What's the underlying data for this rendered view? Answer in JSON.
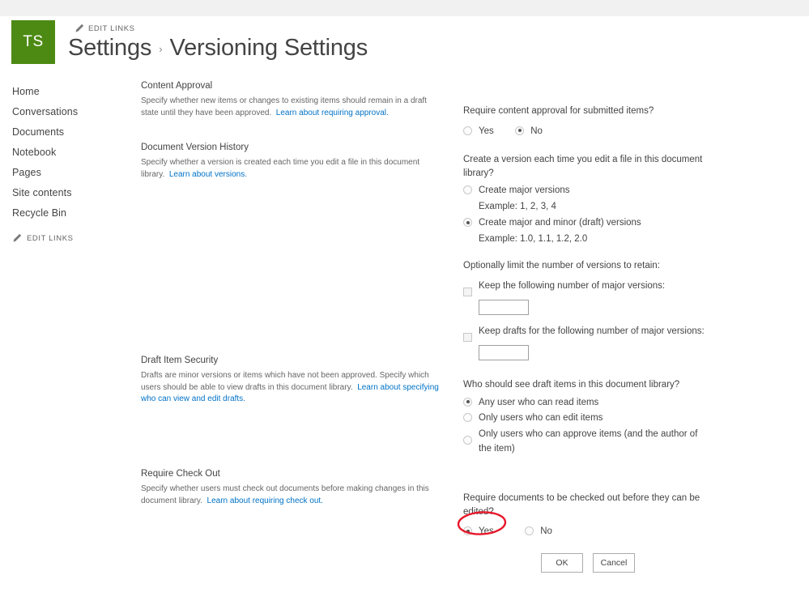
{
  "site": {
    "logo_text": "TS",
    "logo_color": "#4d8a13"
  },
  "header": {
    "edit_links_label": "EDIT LINKS",
    "breadcrumb_parent": "Settings",
    "breadcrumb_separator": "›",
    "breadcrumb_current": "Versioning Settings"
  },
  "sidebar": {
    "items": [
      {
        "label": "Home"
      },
      {
        "label": "Conversations"
      },
      {
        "label": "Documents"
      },
      {
        "label": "Notebook"
      },
      {
        "label": "Pages"
      },
      {
        "label": "Site contents"
      },
      {
        "label": "Recycle Bin"
      }
    ],
    "edit_links_label": "EDIT LINKS"
  },
  "sections": {
    "content_approval": {
      "heading": "Content Approval",
      "description": "Specify whether new items or changes to existing items should remain in a draft state until they have been approved.",
      "link_text": "Learn about requiring approval.",
      "question": "Require content approval for submitted items?",
      "options": [
        {
          "label": "Yes",
          "checked": false
        },
        {
          "label": "No",
          "checked": true
        }
      ]
    },
    "version_history": {
      "heading": "Document Version History",
      "description": "Specify whether a version is created each time you edit a file in this document library.",
      "link_text": "Learn about versions.",
      "question": "Create a version each time you edit a file in this document library?",
      "options": [
        {
          "label": "Create major versions",
          "example": "Example: 1, 2, 3, 4",
          "checked": false
        },
        {
          "label": "Create major and minor (draft) versions",
          "example": "Example: 1.0, 1.1, 1.2, 2.0",
          "checked": true
        }
      ],
      "limit_question": "Optionally limit the number of versions to retain:",
      "limits": [
        {
          "label": "Keep the following number of major versions:",
          "checked": false,
          "value": ""
        },
        {
          "label": "Keep drafts for the following number of major versions:",
          "checked": false,
          "value": ""
        }
      ]
    },
    "draft_security": {
      "heading": "Draft Item Security",
      "description": "Drafts are minor versions or items which have not been approved. Specify which users should be able to view drafts in this document library.",
      "link_text": "Learn about specifying who can view and edit drafts.",
      "question": "Who should see draft items in this document library?",
      "options": [
        {
          "label": "Any user who can read items",
          "checked": true
        },
        {
          "label": "Only users who can edit items",
          "checked": false
        },
        {
          "label": "Only users who can approve items (and the author of the item)",
          "checked": false
        }
      ]
    },
    "require_checkout": {
      "heading": "Require Check Out",
      "description": "Specify whether users must check out documents before making changes in this document library.",
      "link_text": "Learn about requiring check out.",
      "question": "Require documents to be checked out before they can be edited?",
      "options": [
        {
          "label": "Yes",
          "checked": true
        },
        {
          "label": "No",
          "checked": false
        }
      ]
    }
  },
  "footer": {
    "ok_label": "OK",
    "cancel_label": "Cancel"
  },
  "annotation": {
    "color": "#e8172a",
    "target": "require-checkout-yes-radio"
  }
}
